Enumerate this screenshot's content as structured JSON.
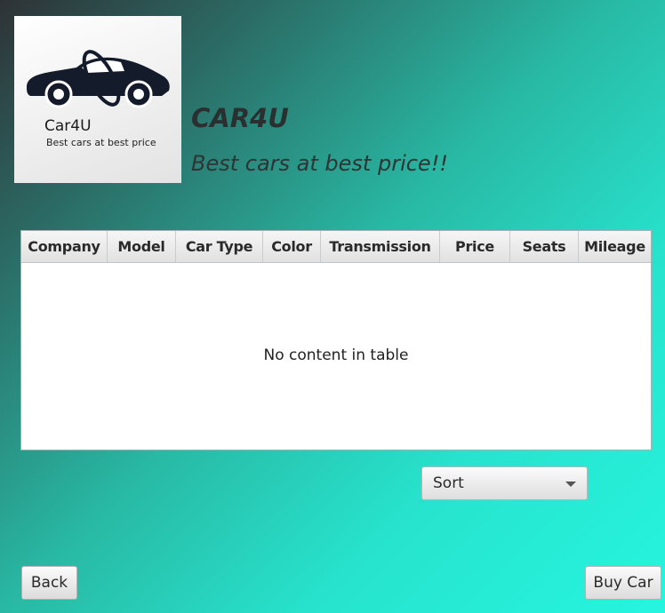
{
  "logo": {
    "name": "Car4U",
    "tagline": "Best cars at best price"
  },
  "header": {
    "title": "CAR4U",
    "subtitle": "Best cars at best price!!"
  },
  "table": {
    "columns": [
      "Company",
      "Model",
      "Car Type",
      "Color",
      "Transmission",
      "Price",
      "Seats",
      "Mileage"
    ],
    "empty_message": "No content in table"
  },
  "sort": {
    "selected": "Sort"
  },
  "buttons": {
    "back_label": "Back",
    "buy_label": "Buy Car"
  },
  "colors": {
    "background_start": "#2e3236",
    "background_end": "#26f5df"
  }
}
